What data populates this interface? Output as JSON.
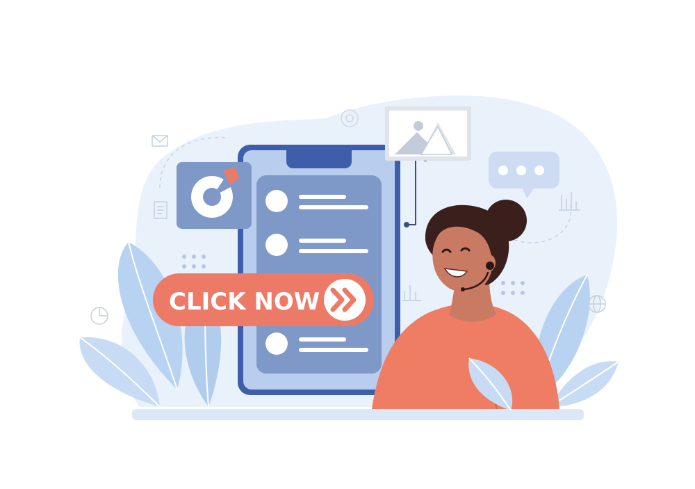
{
  "cta": {
    "label": "CLICK NOW"
  },
  "icons": {
    "mail": "mail-icon",
    "target": "target-icon",
    "image": "image-icon",
    "chat": "chat-bubble-icon",
    "document": "document-icon",
    "pie": "pie-chart-icon",
    "bar": "bar-chart-icon",
    "globe": "globe-icon",
    "arrows": "double-chevron-right-icon",
    "headset": "headset-icon"
  },
  "colors": {
    "cta": "#ed7a67",
    "phone_frame": "#3f5ea9",
    "phone_screen": "#b9cdef",
    "list_panel": "#7e98c7",
    "blob": "#e8f1fb",
    "leaf": "#b9d4f1",
    "skin": "#c97a62",
    "hair": "#3a1f1c",
    "shirt": "#ef7d63"
  },
  "phone": {
    "list_items": [
      {
        "kind": "item"
      },
      {
        "kind": "item"
      },
      {
        "kind": "item"
      }
    ]
  }
}
